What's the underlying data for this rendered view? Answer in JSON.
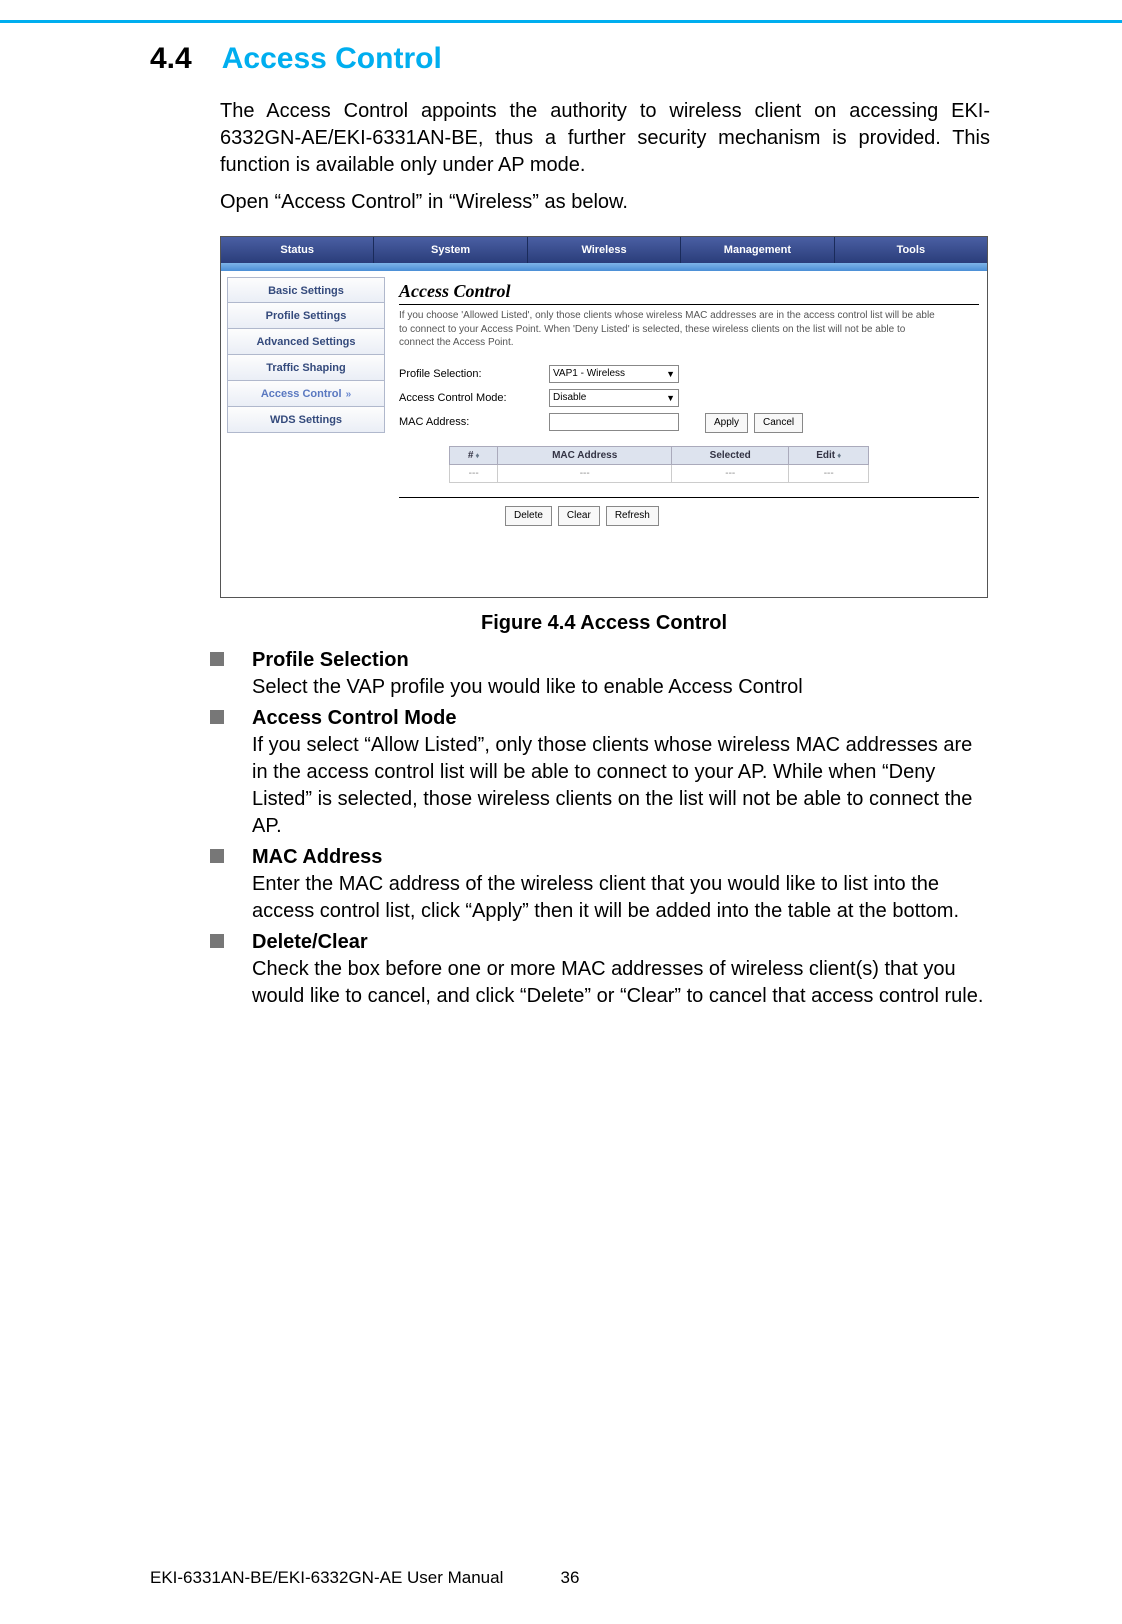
{
  "section": {
    "number": "4.4",
    "title": "Access Control"
  },
  "paragraphs": {
    "p1": "The Access Control appoints the authority to wireless client on accessing EKI-6332GN-AE/EKI-6331AN-BE, thus a further security mechanism is provided. This function is available only under AP mode.",
    "p2": "Open “Access Control” in “Wireless” as below."
  },
  "screenshot": {
    "topTabs": [
      "Status",
      "System",
      "Wireless",
      "Management",
      "Tools"
    ],
    "sideMenu": [
      "Basic Settings",
      "Profile Settings",
      "Advanced Settings",
      "Traffic Shaping",
      "Access Control",
      "WDS Settings"
    ],
    "activeSide": "Access Control",
    "panelTitle": "Access Control",
    "helpText": "If you choose 'Allowed Listed', only those clients whose wireless MAC addresses are in the access control list will be able to connect to your Access Point. When 'Deny Listed' is selected, these wireless clients on the list will not be able to connect the Access Point.",
    "form": {
      "profileLabel": "Profile Selection:",
      "profileValue": "VAP1 - Wireless",
      "modeLabel": "Access Control Mode:",
      "modeValue": "Disable",
      "macLabel": "MAC Address:"
    },
    "buttons": {
      "apply": "Apply",
      "cancel": "Cancel",
      "delete": "Delete",
      "clear": "Clear",
      "refresh": "Refresh"
    },
    "table": {
      "headers": [
        "#",
        "MAC Address",
        "Selected",
        "Edit"
      ],
      "emptyRow": [
        "---",
        "---",
        "---",
        "---"
      ]
    }
  },
  "figureCaption": "Figure 4.4 Access Control",
  "bullets": [
    {
      "title": "Profile Selection",
      "desc": "Select the VAP profile you would like to enable Access Control"
    },
    {
      "title": "Access Control Mode",
      "desc": "If you select “Allow Listed”, only those clients whose wireless MAC addresses are in the access control list will be able to connect to your AP. While when “Deny Listed” is selected, those wireless clients on the list will not be able to connect the AP."
    },
    {
      "title": "MAC Address",
      "desc": "Enter the MAC address of the wireless client that you would like to list into the access control list, click “Apply” then it will be added into the table at the bottom."
    },
    {
      "title": "Delete/Clear",
      "desc": "Check the box before one or more MAC addresses of wireless client(s) that you would like to cancel, and click “Delete” or “Clear” to cancel that access control rule."
    }
  ],
  "footer": {
    "manual": "EKI-6331AN-BE/EKI-6332GN-AE User Manual",
    "page": "36"
  }
}
